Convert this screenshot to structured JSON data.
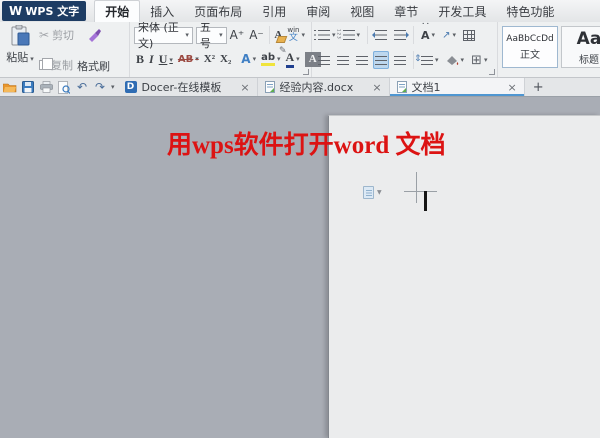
{
  "titlebar": {
    "logo_text": "WPS 文字",
    "logo_w": "W",
    "tabs": [
      {
        "label": "开始"
      },
      {
        "label": "插入"
      },
      {
        "label": "页面布局"
      },
      {
        "label": "引用"
      },
      {
        "label": "审阅"
      },
      {
        "label": "视图"
      },
      {
        "label": "章节"
      },
      {
        "label": "开发工具"
      },
      {
        "label": "特色功能"
      }
    ]
  },
  "ribbon": {
    "clipboard": {
      "paste": "粘贴",
      "cut": "剪切",
      "copy": "复制",
      "format_painter": "格式刷"
    },
    "font": {
      "family": "宋体 (正文)",
      "size": "五号",
      "grow": "A⁺",
      "shrink": "A⁻",
      "clear": "A",
      "pinyin_top": "win",
      "pinyin_bottom": "文",
      "bold": "B",
      "italic": "I",
      "underline": "U",
      "strike": "AB",
      "superscript": "X²",
      "subscript": "X₂",
      "text_effect": "A",
      "highlight": "ab",
      "font_color": "A",
      "char_shading": "A"
    },
    "styles": [
      {
        "preview": "AaBbCcDd",
        "name": "正文"
      },
      {
        "preview": "Aa",
        "name": "标题"
      }
    ]
  },
  "tabbar": {
    "documents": [
      {
        "label": "Docer-在线模板"
      },
      {
        "label": "经验内容.docx"
      },
      {
        "label": "文档1"
      }
    ],
    "docer_letter": "D",
    "close": "×",
    "new_tab": "+"
  },
  "canvas": {
    "annotation": "用wps软件打开word 文档"
  },
  "colors": {
    "logo_bg": "#1d3c63",
    "accent_blue": "#4f96d1",
    "annotation_red": "#dc1313",
    "canvas_gray": "#a9adb5",
    "page_bg": "#ebeced",
    "highlight_yellow": "#f0e43c",
    "brush_purple": "#a473d8"
  }
}
